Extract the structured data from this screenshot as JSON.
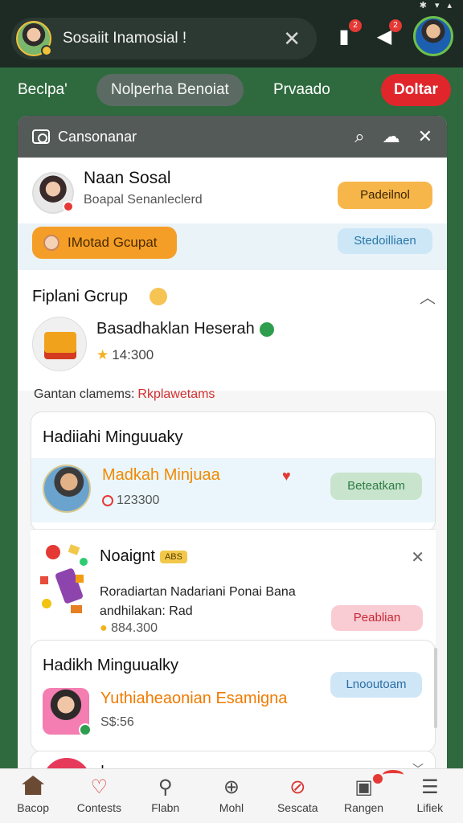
{
  "header": {
    "search_text": "Sosaiit Inamosial !",
    "notif_badge_1": "2",
    "notif_badge_2": "2"
  },
  "tabs": [
    "Beclpa'",
    "Nolperha Benoiat",
    "Prvaado",
    "Doltar"
  ],
  "modal": {
    "title": "Cansonanar",
    "profile": {
      "name": "Naan Sosal",
      "subtitle": "Boapal Senanleclerd",
      "primary_button": "Padeilnol",
      "group_button": "IMotad Gcupat",
      "secondary_button": "Stedoilliaen"
    },
    "featured": {
      "section_title": "Fiplani Gcrup",
      "item_name": "Basadhaklan Heserah",
      "rating": "14:300",
      "footer_label": "Gantan clamems:",
      "footer_link": "Rkplawetams"
    },
    "weekly_card_1": {
      "heading": "Hadiiahi Minguuaky",
      "row_title": "Madkah Minjuaa",
      "row_meta": "123300",
      "button": "Beteatkam"
    },
    "notification": {
      "title": "Noaignt",
      "tag": "ABS",
      "body": "Roradiartan Nadariani Ponai Bana andhilakan: Rad",
      "meta": "884.300",
      "button": "Peablian"
    },
    "weekly_card_2": {
      "heading": "Hadikh Minguualky",
      "row_title": "Yuthiaheaonian Esamigna",
      "row_meta": "S$:56",
      "button": "Lnooutoam"
    },
    "peek_title": "I..."
  },
  "bottom_nav": [
    {
      "label": "Bacop",
      "icon": "home-icon"
    },
    {
      "label": "Contests",
      "icon": "heart-icon"
    },
    {
      "label": "Flabn",
      "icon": "person-icon"
    },
    {
      "label": "Mohl",
      "icon": "plus-circle-icon"
    },
    {
      "label": "Sescata",
      "icon": "tag-icon"
    },
    {
      "label": "Rangen",
      "icon": "message-icon"
    },
    {
      "label": "Lifiek",
      "icon": "menu-icon"
    }
  ]
}
